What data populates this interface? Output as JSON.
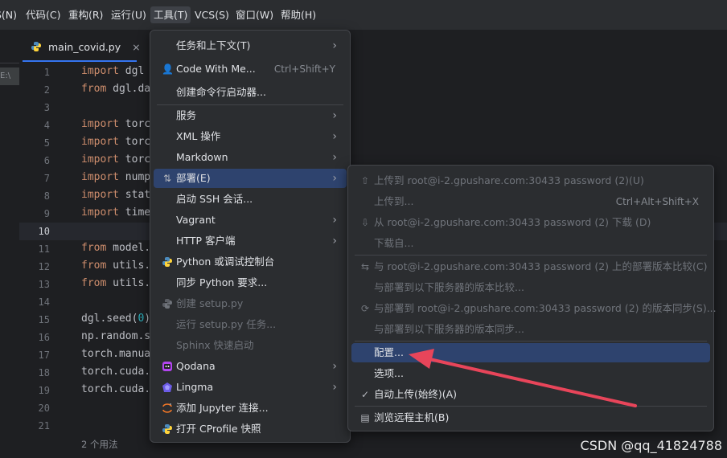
{
  "menubar": {
    "items": [
      {
        "label": "S(N)",
        "name": "menu-partial"
      },
      {
        "label": "代码(C)",
        "name": "menu-code"
      },
      {
        "label": "重构(R)",
        "name": "menu-refactor"
      },
      {
        "label": "运行(U)",
        "name": "menu-run"
      },
      {
        "label": "工具(T)",
        "name": "menu-tools"
      },
      {
        "label": "VCS(S)",
        "name": "menu-vcs"
      },
      {
        "label": "窗口(W)",
        "name": "menu-window"
      },
      {
        "label": "帮助(H)",
        "name": "menu-help"
      }
    ]
  },
  "tab": {
    "filename": "main_covid.py",
    "close": "×"
  },
  "path_chip": "E:\\",
  "editor": {
    "lines": [
      {
        "n": "1",
        "kw": "import",
        "rest": " dgl"
      },
      {
        "n": "2",
        "kw": "from",
        "rest": " dgl.da"
      },
      {
        "n": "3",
        "kw": "",
        "rest": ""
      },
      {
        "n": "4",
        "kw": "import",
        "rest": " torc"
      },
      {
        "n": "5",
        "kw": "import",
        "rest": " torc"
      },
      {
        "n": "6",
        "kw": "import",
        "rest": " torc"
      },
      {
        "n": "7",
        "kw": "import",
        "rest": " nump"
      },
      {
        "n": "8",
        "kw": "import",
        "rest": " stat"
      },
      {
        "n": "9",
        "kw": "import",
        "rest": " time"
      },
      {
        "n": "10",
        "kw": "",
        "rest": ""
      },
      {
        "n": "11",
        "kw": "from",
        "rest": " model."
      },
      {
        "n": "12",
        "kw": "from",
        "rest": " utils."
      },
      {
        "n": "13",
        "kw": "from",
        "rest": " utils."
      },
      {
        "n": "14",
        "kw": "",
        "rest": ""
      },
      {
        "n": "15",
        "kw": "",
        "rest": "dgl.seed(",
        "num": "0",
        "tail": ")"
      },
      {
        "n": "16",
        "kw": "",
        "rest": "np.random.s"
      },
      {
        "n": "17",
        "kw": "",
        "rest": "torch.manua"
      },
      {
        "n": "18",
        "kw": "",
        "rest": "torch.cuda."
      },
      {
        "n": "19",
        "kw": "",
        "rest": "torch.cuda."
      },
      {
        "n": "20",
        "kw": "",
        "rest": ""
      },
      {
        "n": "21",
        "kw": "",
        "rest": ""
      }
    ],
    "usages": "2 个用法"
  },
  "tools_menu": {
    "items": [
      {
        "label": "任务和上下文(T)",
        "arrow": "›"
      },
      {
        "label": "Code With Me...",
        "shortcut": "Ctrl+Shift+Y",
        "icon": "👤"
      },
      {
        "label": "创建命令行启动器..."
      },
      {
        "label": "服务",
        "arrow": "›"
      },
      {
        "label": "XML 操作",
        "arrow": "›"
      },
      {
        "label": "Markdown",
        "arrow": "›"
      },
      {
        "label": "部署(E)",
        "arrow": "›",
        "icon": "⇅"
      },
      {
        "label": "启动 SSH 会话..."
      },
      {
        "label": "Vagrant",
        "arrow": "›"
      },
      {
        "label": "HTTP 客户端",
        "arrow": "›"
      },
      {
        "label": "Python 或调试控制台"
      },
      {
        "label": "同步 Python 要求..."
      },
      {
        "label": "创建 setup.py"
      },
      {
        "label": "运行 setup.py 任务..."
      },
      {
        "label": "Sphinx 快速启动"
      },
      {
        "label": "Qodana",
        "arrow": "›"
      },
      {
        "label": "Lingma",
        "arrow": "›"
      },
      {
        "label": "添加 Jupyter 连接..."
      },
      {
        "label": "打开 CProfile 快照"
      }
    ]
  },
  "deploy_menu": {
    "items": [
      {
        "label": "上传到 root@i-2.gpushare.com:30433 password (2)(U)",
        "icon": "⇧"
      },
      {
        "label": "上传到...",
        "shortcut": "Ctrl+Alt+Shift+X"
      },
      {
        "label": "从 root@i-2.gpushare.com:30433 password (2) 下载 (D)",
        "icon": "⇩"
      },
      {
        "label": "下载自..."
      },
      {
        "label": "与 root@i-2.gpushare.com:30433 password (2) 上的部署版本比较(C)",
        "icon": "⇆"
      },
      {
        "label": "与部署到以下服务器的版本比较..."
      },
      {
        "label": "与部署到 root@i-2.gpushare.com:30433 password (2) 的版本同步(S)...",
        "icon": "⟳"
      },
      {
        "label": "与部署到以下服务器的版本同步..."
      },
      {
        "label": "配置..."
      },
      {
        "label": "选项..."
      },
      {
        "label": "自动上传(始终)(A)",
        "icon": "✓"
      },
      {
        "label": "浏览远程主机(B)",
        "icon": "▤"
      }
    ]
  },
  "watermark": "CSDN @qq_41824788",
  "colors": {
    "accent": "#3574f0",
    "selection": "#2e436e",
    "arrow": "#e8455a"
  }
}
